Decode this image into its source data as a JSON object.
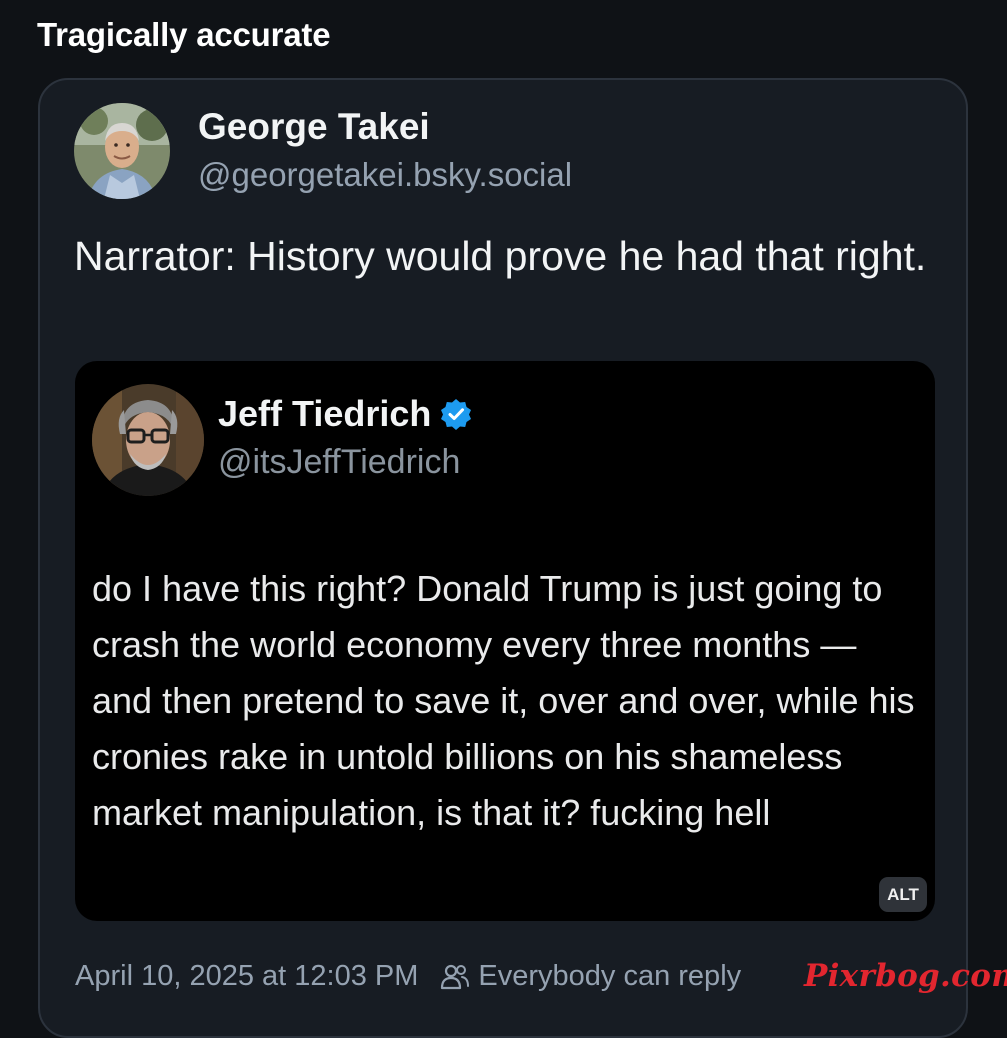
{
  "header": {
    "title": "Tragically accurate"
  },
  "post": {
    "author_name": "George Takei",
    "author_handle": "@georgetakei.bsky.social",
    "text": "Narrator: History would prove he had that right.",
    "quoted": {
      "author_name": "Jeff Tiedrich",
      "verified_icon": "verified-badge-icon",
      "author_handle": "@itsJeffTiedrich",
      "text": "do I have this right? Donald Trump is just going to crash the world economy every three months — and then pretend to save it, over and over, while his cronies rake in untold billions on his shameless market manipulation, is that it? fucking hell",
      "alt_label": "ALT"
    },
    "timestamp": "April 10, 2025 at 12:03 PM",
    "reply_icon": "people-icon",
    "reply_setting": "Everybody can reply"
  },
  "watermark": "Pixrbog.com",
  "colors": {
    "background": "#0f1216",
    "card": "#171c23",
    "muted_text": "#95a2b1",
    "verified_blue": "#1d9bf0",
    "watermark_red": "#e2262f"
  }
}
